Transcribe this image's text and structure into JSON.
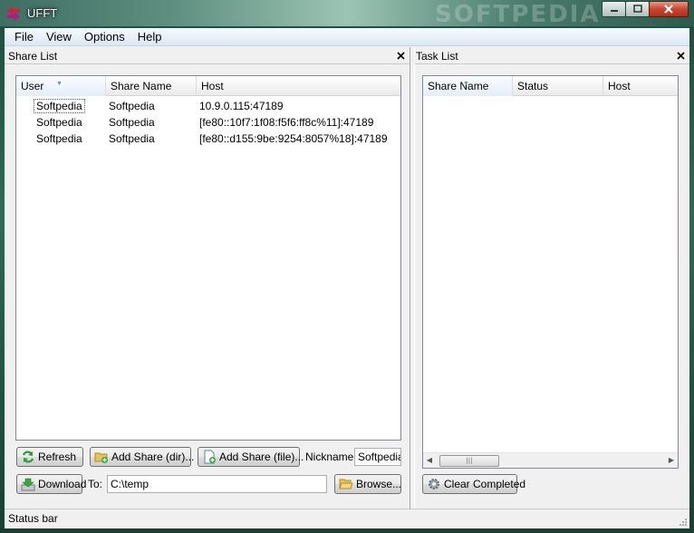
{
  "window": {
    "title": "UFFT",
    "watermark": "SOFTPEDIA"
  },
  "menu": [
    "File",
    "View",
    "Options",
    "Help"
  ],
  "share_list": {
    "title": "Share List",
    "columns": [
      "User",
      "Share Name",
      "Host"
    ],
    "rows": [
      {
        "user": "Softpedia",
        "share": "Softpedia",
        "host": "10.9.0.115:47189"
      },
      {
        "user": "Softpedia",
        "share": "Softpedia",
        "host": "[fe80::10f7:1f08:f5f6:ff8c%11]:47189"
      },
      {
        "user": "Softpedia",
        "share": "Softpedia",
        "host": "[fe80::d155:9be:9254:8057%18]:47189"
      }
    ],
    "buttons": {
      "refresh": "Refresh",
      "add_dir": "Add Share (dir)...",
      "add_file": "Add Share (file)...",
      "download": "Download",
      "browse": "Browse..."
    },
    "nickname_label": "Nickname:",
    "nickname_value": "Softpedia",
    "to_label": "To:",
    "to_value": "C:\\temp"
  },
  "task_list": {
    "title": "Task List",
    "columns": [
      "Share Name",
      "Status",
      "Host"
    ],
    "clear_button": "Clear Completed"
  },
  "status_bar": "Status bar",
  "colors": {
    "accent": "#3a7bd5",
    "title_gradient": "#5f8f80"
  }
}
